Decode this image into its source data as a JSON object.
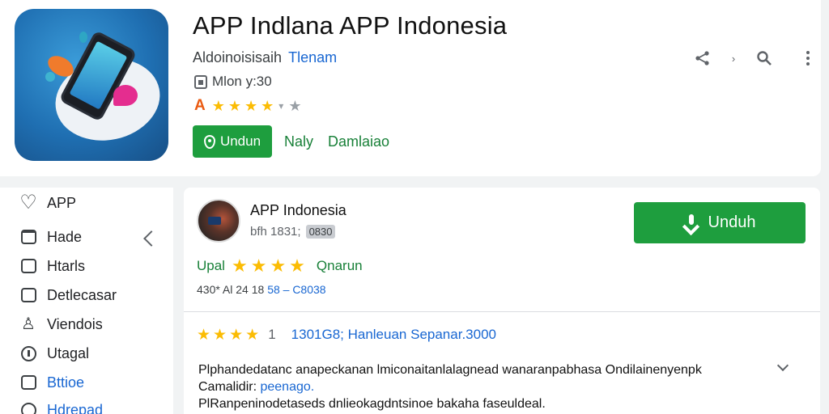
{
  "header": {
    "title": "APP Indlana APP Indonesia",
    "developer": "Aldoinoisisaih",
    "developer_link": "Tlenam",
    "meta": "Mlon y:30",
    "rating_badge": "A",
    "rating_stars": 4,
    "buttons": {
      "unduh": "Undun",
      "secondary": "Naly",
      "tertiary": "Damlaiao"
    },
    "toolbar_icons": [
      "share-icon",
      "forward-icon",
      "search-icon",
      "more-vert-icon"
    ]
  },
  "sidebar": {
    "items": [
      {
        "label": "APP",
        "icon": "heart-icon"
      },
      {
        "label": "Hade",
        "icon": "box-icon"
      },
      {
        "label": "Htarls",
        "icon": "chat-icon"
      },
      {
        "label": "Detlecasar",
        "icon": "message-icon"
      },
      {
        "label": "Viendois",
        "icon": "person-icon"
      },
      {
        "label": "Utagal",
        "icon": "info-icon"
      },
      {
        "label": "Bttioe",
        "icon": "comment-icon"
      },
      {
        "label": "Hdrepad",
        "icon": "location-icon"
      }
    ]
  },
  "card": {
    "title": "APP Indonesia",
    "subtitle": "bfh 1831;",
    "subtitle_chip": "0830",
    "download_label": "Unduh",
    "rating_label": "Upal",
    "rating_stars": 4,
    "rating_secondary": "Qnarun",
    "stats_text": "430* Al 24 18",
    "stats_link": "58 – C8038",
    "review": {
      "stars": 4,
      "count": "1",
      "link": "1301G8; Hanleuan Sepanar.3000",
      "line1": "Plphandedatanc anapeckanan lmiconaitanlalagnead wanaranpabhasa Ondilainenyenpk",
      "line2_prefix": "Camalidir: ",
      "line2_link": "peenago.",
      "line3": "PlRanpeninodetaseds dnlieokagdntsinoe bakaha faseuldeal."
    }
  },
  "colors": {
    "accent_green": "#1e9e3e",
    "link_blue": "#1967d2",
    "star_yellow": "#fbbc04"
  }
}
